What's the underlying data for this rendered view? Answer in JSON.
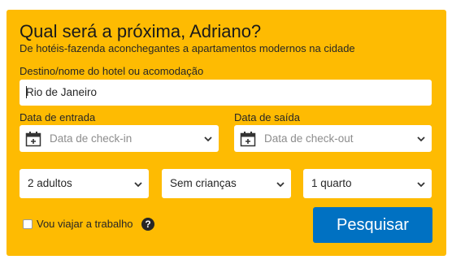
{
  "header": {
    "title": "Qual será a próxima, Adriano?",
    "subtitle": "De hotéis-fazenda aconchegantes a apartamentos modernos na cidade"
  },
  "destination": {
    "label": "Destino/nome do hotel ou acomodação",
    "value": "Rio de Janeiro"
  },
  "checkin": {
    "label": "Data de entrada",
    "placeholder": "Data de check-in",
    "icon": "calendar-icon"
  },
  "checkout": {
    "label": "Data de saída",
    "placeholder": "Data de check-out",
    "icon": "calendar-icon"
  },
  "guests": {
    "adults": "2 adultos",
    "children": "Sem crianças",
    "rooms": "1 quarto"
  },
  "work_trip": {
    "label": "Vou viajar a trabalho",
    "checked": false,
    "help_icon": "?"
  },
  "search_button": "Pesquisar",
  "colors": {
    "panel": "#febb02",
    "button": "#0071c2"
  }
}
